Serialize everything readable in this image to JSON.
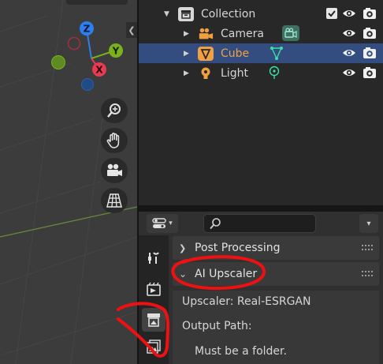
{
  "outliner": {
    "rows": [
      {
        "label": "Collection",
        "icon": "collection-icon"
      },
      {
        "label": "Camera",
        "icon": "camera-object-icon",
        "data_icon": "camera-data-icon"
      },
      {
        "label": "Cube",
        "icon": "mesh-object-icon",
        "data_icon": "mesh-data-icon",
        "selected": true
      },
      {
        "label": "Light",
        "icon": "light-object-icon",
        "data_icon": "light-data-icon"
      }
    ]
  },
  "gizmo": {
    "z": "Z",
    "y": "Y",
    "x": "X"
  },
  "properties": {
    "panels": [
      {
        "title": "Post Processing",
        "expanded": false
      },
      {
        "title": "AI Upscaler",
        "expanded": true
      }
    ],
    "upscaler_line": "Upscaler: Real-ESRGAN",
    "output_path_label": "Output Path:",
    "folder_note": "Must be a folder."
  },
  "colors": {
    "selected_row": "#334d80",
    "active_label": "#f0a040",
    "annotation": "#ee1111",
    "axis_x": "#e83a52",
    "axis_y": "#7ab21d",
    "axis_z": "#2d7ef0"
  }
}
